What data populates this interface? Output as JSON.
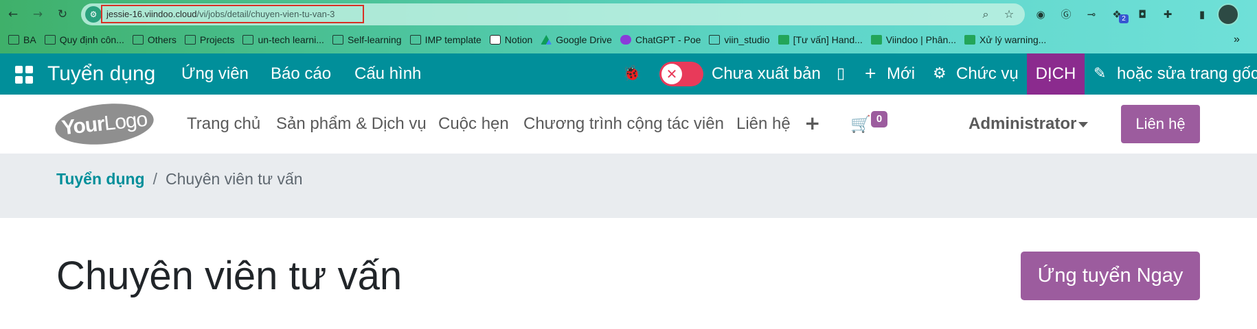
{
  "browser": {
    "url_host": "jessie-16.viindoo.cloud",
    "url_path": "/vi/jobs/detail/chuyen-vien-tu-van-3",
    "ext_badge_count": "2",
    "bookmarks": [
      {
        "label": "BA",
        "icon": "folder-icon"
      },
      {
        "label": "Quy định côn...",
        "icon": "folder-icon"
      },
      {
        "label": "Others",
        "icon": "folder-icon"
      },
      {
        "label": "Projects",
        "icon": "folder-icon"
      },
      {
        "label": "un-tech learni...",
        "icon": "folder-icon"
      },
      {
        "label": "Self-learning",
        "icon": "folder-icon"
      },
      {
        "label": "IMP template",
        "icon": "folder-icon"
      },
      {
        "label": "Notion",
        "icon": "notion-icon"
      },
      {
        "label": "Google Drive",
        "icon": "drive-icon"
      },
      {
        "label": "ChatGPT - Poe",
        "icon": "poe-icon"
      },
      {
        "label": "viin_studio",
        "icon": "folder-icon"
      },
      {
        "label": "[Tư vấn] Hand...",
        "icon": "sheet-icon"
      },
      {
        "label": "Viindoo | Phân...",
        "icon": "sheet-icon"
      },
      {
        "label": "Xử lý warning...",
        "icon": "sheet-icon"
      }
    ]
  },
  "odoo_bar": {
    "app_title": "Tuyển dụng",
    "menu": [
      "Ứng viên",
      "Báo cáo",
      "Cấu hình"
    ],
    "publish_status": "Chưa xuất bản",
    "new_label": "Mới",
    "position_label": "Chức vụ",
    "translate_label": "DỊCH",
    "edit_label": "hoặc sửa trang gốc"
  },
  "site_header": {
    "logo_bold": "Your",
    "logo_light": "Logo",
    "menu": [
      "Trang chủ",
      "Sản phẩm & Dịch vụ",
      "Cuộc hẹn",
      "Chương trình cộng tác viên",
      "Liên hệ"
    ],
    "cart_count": "0",
    "user": "Administrator",
    "contact_button": "Liên hệ"
  },
  "breadcrumb": {
    "parent": "Tuyển dụng",
    "separator": "/",
    "current": "Chuyên viên tư vấn"
  },
  "main": {
    "job_title": "Chuyên viên tư vấn",
    "apply_button": "Ứng tuyển Ngay"
  },
  "colors": {
    "odoo_bar": "#018f9a",
    "translate_bg": "#8b2b8e",
    "brand_button": "#9c5c9e",
    "toggle_off": "#e83a5a",
    "breadcrumb_band": "#e9ecef"
  }
}
